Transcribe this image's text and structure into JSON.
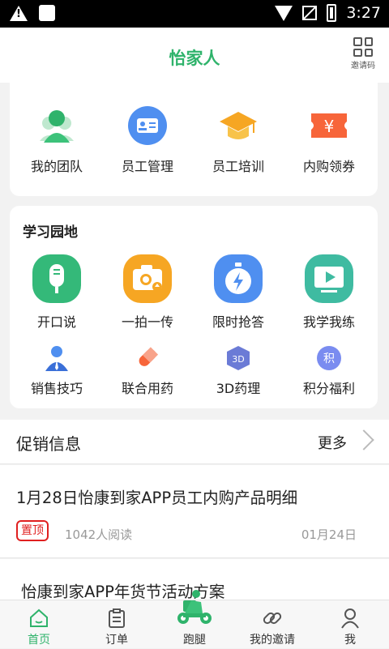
{
  "status_bar": {
    "time": "3:27",
    "icons": [
      "warning-icon",
      "square-icon",
      "wifi-icon",
      "no-signal-icon",
      "battery-charging-icon"
    ]
  },
  "header": {
    "title": "怡家人",
    "invite_label": "邀请码"
  },
  "colors": {
    "brand_green": "#2fb36b",
    "blue": "#4f8ff0",
    "orange": "#f6a623",
    "red": "#e02020"
  },
  "quick_menu": {
    "items": [
      {
        "label": "我的团队",
        "icon": "team-icon"
      },
      {
        "label": "员工管理",
        "icon": "staff-card-icon"
      },
      {
        "label": "员工培训",
        "icon": "graduation-cap-icon"
      },
      {
        "label": "内购领券",
        "icon": "coupon-icon"
      }
    ]
  },
  "study": {
    "title": "学习园地",
    "row1": [
      {
        "label": "开口说",
        "icon": "microphone-icon"
      },
      {
        "label": "一拍一传",
        "icon": "camera-upload-icon"
      },
      {
        "label": "限时抢答",
        "icon": "stopwatch-icon"
      },
      {
        "label": "我学我练",
        "icon": "video-play-icon"
      }
    ],
    "row2": [
      {
        "label": "销售技巧",
        "icon": "salesperson-icon"
      },
      {
        "label": "联合用药",
        "icon": "pill-icon"
      },
      {
        "label": "3D药理",
        "icon": "3d-cube-icon",
        "icon_text": "3D"
      },
      {
        "label": "积分福利",
        "icon": "points-icon",
        "icon_text": "积"
      }
    ]
  },
  "promo": {
    "title": "促销信息",
    "more_label": "更多"
  },
  "articles": [
    {
      "title": "1月28日怡康到家APP员工内购产品明细",
      "badge": "置顶",
      "reads": "1042人阅读",
      "date": "01月24日"
    },
    {
      "title": "怡康到家APP年货节活动方案"
    }
  ],
  "tabbar": {
    "active": 0,
    "tabs": [
      {
        "label": "首页",
        "icon": "home-icon"
      },
      {
        "label": "订单",
        "icon": "clipboard-icon"
      },
      {
        "label": "跑腿",
        "icon": "delivery-scooter-icon"
      },
      {
        "label": "我的邀请",
        "icon": "link-icon"
      },
      {
        "label": "我",
        "icon": "user-icon"
      }
    ]
  }
}
